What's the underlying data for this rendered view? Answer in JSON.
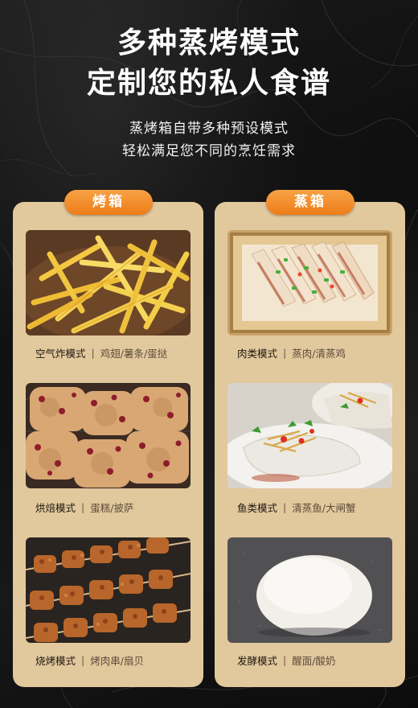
{
  "header": {
    "title_line1": "多种蒸烤模式",
    "title_line2": "定制您的私人食谱",
    "subtitle_line1": "蒸烤箱自带多种预设模式",
    "subtitle_line2": "轻松满足您不同的烹饪需求"
  },
  "colors": {
    "accent_orange": "#f08a25",
    "panel_beige": "#e2c89d",
    "background": "#111111"
  },
  "oven": {
    "label": "烤箱",
    "modes": [
      {
        "mode": "空气炸模式",
        "separator": "|",
        "items": "鸡翅/薯条/蛋挞",
        "image": "french-fries"
      },
      {
        "mode": "烘焙模式",
        "separator": "|",
        "items": "蛋糕/披萨",
        "image": "cranberry-scones"
      },
      {
        "mode": "烧烤模式",
        "separator": "|",
        "items": "烤肉串/扇贝",
        "image": "grilled-skewers"
      }
    ]
  },
  "steamer": {
    "label": "蒸箱",
    "modes": [
      {
        "mode": "肉类模式",
        "separator": "|",
        "items": "蒸肉/清蒸鸡",
        "image": "steamed-pork"
      },
      {
        "mode": "鱼类模式",
        "separator": "|",
        "items": "清蒸鱼/大闸蟹",
        "image": "steamed-fish"
      },
      {
        "mode": "发酵模式",
        "separator": "|",
        "items": "醒面/酸奶",
        "image": "dough-ball"
      }
    ]
  }
}
